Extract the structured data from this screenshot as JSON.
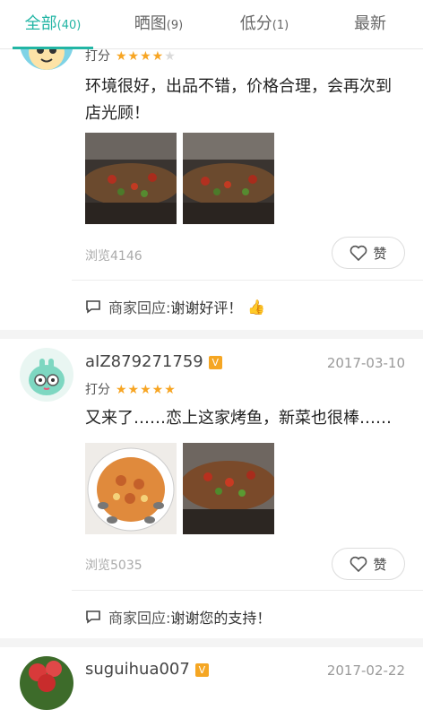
{
  "tabs": [
    {
      "label": "全部",
      "count": "(40)"
    },
    {
      "label": "晒图",
      "count": "(9)"
    },
    {
      "label": "低分",
      "count": "(1)"
    },
    {
      "label": "最新",
      "count": ""
    }
  ],
  "reviews": [
    {
      "rating_label": "打分",
      "stars": 4,
      "text": "环境很好，出品不错，价格合理，会再次到店光顾！",
      "views": "浏览4146",
      "like_label": "赞",
      "reply_prefix": "商家回应:",
      "reply": "谢谢好评！",
      "reply_emoji": "👍"
    },
    {
      "username": "aIZ879271759",
      "badge": "V",
      "date": "2017-03-10",
      "rating_label": "打分",
      "stars": 5,
      "text": "又来了……恋上这家烤鱼，新菜也很棒……",
      "views": "浏览5035",
      "like_label": "赞",
      "reply_prefix": "商家回应:",
      "reply": "谢谢您的支持！"
    },
    {
      "username": "suguihua007",
      "badge": "V",
      "date": "2017-02-22"
    }
  ],
  "colors": {
    "accent": "#22b5a4",
    "star": "#f7a523",
    "badge": "#f5a623"
  }
}
